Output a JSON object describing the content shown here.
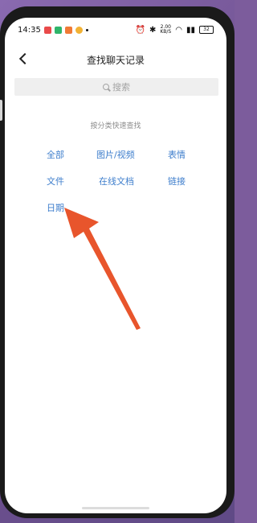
{
  "status_bar": {
    "time": "14:35",
    "network_speed": "2.00\nKB/S",
    "battery": "32"
  },
  "nav": {
    "title": "查找聊天记录"
  },
  "search": {
    "placeholder": "搜索"
  },
  "section_label": "按分类快速查找",
  "categories": [
    {
      "label": "全部"
    },
    {
      "label": "图片/视频"
    },
    {
      "label": "表情"
    },
    {
      "label": "文件"
    },
    {
      "label": "在线文档"
    },
    {
      "label": "链接"
    },
    {
      "label": "日期"
    }
  ],
  "colors": {
    "accent": "#3e7ecc",
    "annotation_arrow": "#e8552c"
  },
  "icons": [
    "back-arrow-icon",
    "search-icon",
    "alarm-icon",
    "bluetooth-icon",
    "wifi-icon",
    "signal-icon",
    "battery-icon"
  ]
}
